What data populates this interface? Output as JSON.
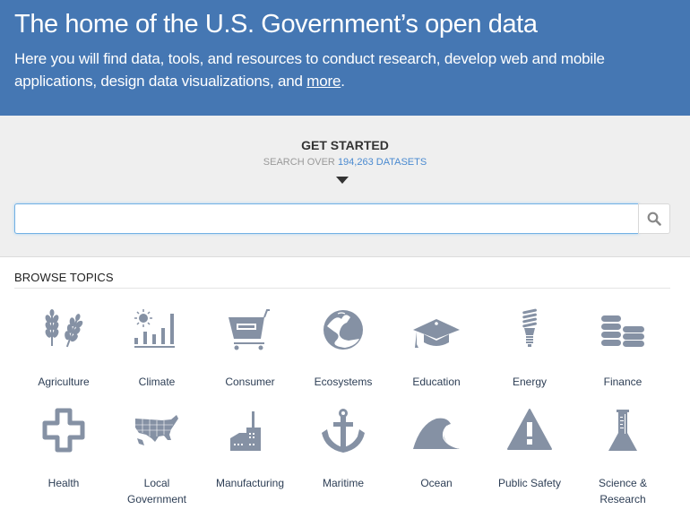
{
  "hero": {
    "title": "The home of the U.S. Government’s open data",
    "subtitle": "Here you will find data, tools, and resources to conduct research, develop web and mobile applications, design data visualizations, and ",
    "more_link": "more",
    "subtitle_end": "."
  },
  "search": {
    "heading": "GET STARTED",
    "sub_prefix": "SEARCH OVER ",
    "dataset_count": "194,263 DATASETS",
    "input_value": "",
    "placeholder": "",
    "button_icon": "search-icon"
  },
  "browse": {
    "heading": "BROWSE TOPICS",
    "topics": [
      {
        "label": "Agriculture",
        "icon": "wheat-icon"
      },
      {
        "label": "Climate",
        "icon": "sun-bar-chart-icon"
      },
      {
        "label": "Consumer",
        "icon": "shopping-cart-icon"
      },
      {
        "label": "Ecosystems",
        "icon": "landscape-globe-icon"
      },
      {
        "label": "Education",
        "icon": "graduation-cap-icon"
      },
      {
        "label": "Energy",
        "icon": "lightbulb-icon"
      },
      {
        "label": "Finance",
        "icon": "coin-stacks-icon"
      },
      {
        "label": "Health",
        "icon": "medical-cross-icon"
      },
      {
        "label": "Local Government",
        "label_line1": "Local",
        "label_line2": "Government",
        "icon": "us-map-icon"
      },
      {
        "label": "Manufacturing",
        "icon": "factory-icon"
      },
      {
        "label": "Maritime",
        "icon": "anchor-icon"
      },
      {
        "label": "Ocean",
        "icon": "wave-icon"
      },
      {
        "label": "Public Safety",
        "icon": "warning-triangle-icon"
      },
      {
        "label": "Science & Research",
        "label_line1": "Science &",
        "label_line2": "Research",
        "icon": "flask-icon"
      }
    ]
  },
  "colors": {
    "hero_bg": "#4577b3",
    "icon_gray": "#8591a4",
    "link_blue": "#4a8ad0"
  }
}
